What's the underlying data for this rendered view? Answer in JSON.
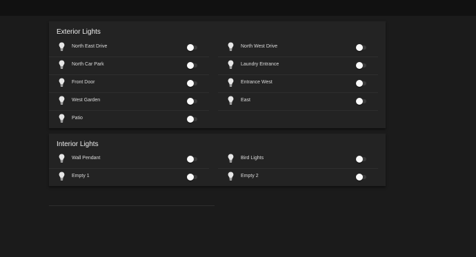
{
  "exterior": {
    "title": "Exterior Lights",
    "left": [
      {
        "label": "North East Drive",
        "on": false
      },
      {
        "label": "North Car Park",
        "on": false
      },
      {
        "label": "Front Door",
        "on": false
      },
      {
        "label": "West Garden",
        "on": false
      },
      {
        "label": "Patio",
        "on": false
      }
    ],
    "right": [
      {
        "label": "North West Drive",
        "on": false
      },
      {
        "label": "Laundry Entrance",
        "on": false
      },
      {
        "label": "Entrance West",
        "on": false
      },
      {
        "label": "East",
        "on": false
      }
    ]
  },
  "interior": {
    "title": "Interior Lights",
    "left": [
      {
        "label": "Wall Pendant",
        "on": false
      },
      {
        "label": "Empty 1",
        "on": false
      }
    ],
    "right": [
      {
        "label": "Bird Lights",
        "on": false
      },
      {
        "label": "Empty 2",
        "on": false
      }
    ]
  },
  "icons": {
    "bulb": "lightbulb-icon"
  },
  "colors": {
    "background": "#1b1b1b",
    "card": "#232323",
    "knob": "#fafafa"
  }
}
